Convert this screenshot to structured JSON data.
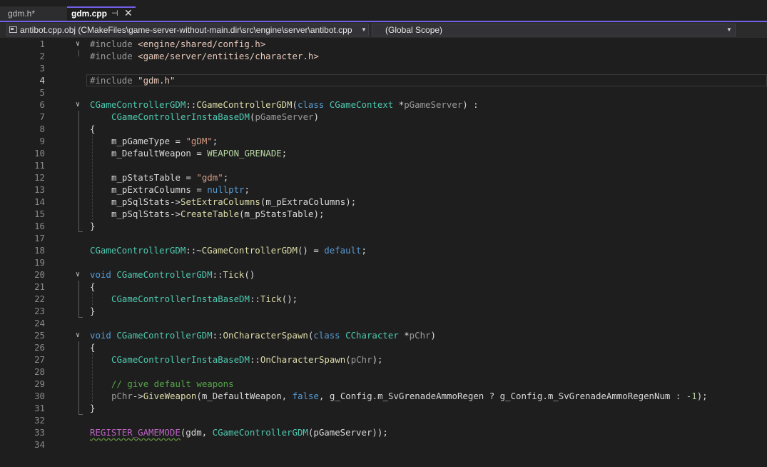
{
  "tabs": {
    "inactive_label": "gdm.h*",
    "active_label": "gdm.cpp",
    "pin_glyph": "⊣",
    "close_glyph": "✕"
  },
  "navbar": {
    "file_label": "antibot.cpp.obj (CMakeFiles\\game-server-without-main.dir\\src\\engine\\server\\antibot.cpp",
    "scope_label": "(Global Scope)",
    "dropdown_glyph": "▼"
  },
  "editor": {
    "current_line": 4,
    "line_numbers": [
      "1",
      "2",
      "3",
      "4",
      "5",
      "6",
      "7",
      "8",
      "9",
      "10",
      "11",
      "12",
      "13",
      "14",
      "15",
      "16",
      "17",
      "18",
      "19",
      "20",
      "21",
      "22",
      "23",
      "24",
      "25",
      "26",
      "27",
      "28",
      "29",
      "30",
      "31",
      "32",
      "33",
      "34"
    ],
    "fold_glyph": "∨",
    "lines": {
      "l1": [
        "#include ",
        "<engine/shared/config.h>"
      ],
      "l2": [
        "#include ",
        "<game/server/entities/character.h>"
      ],
      "l4": [
        "#include ",
        "\"gdm.h\""
      ],
      "l6": [
        "CGameControllerGDM",
        "::",
        "CGameControllerGDM",
        "(",
        "class",
        " ",
        "CGameContext",
        " *",
        "pGameServer",
        ") :"
      ],
      "l7": [
        "CGameControllerInstaBaseDM",
        "(",
        "pGameServer",
        ")"
      ],
      "l8": [
        "{"
      ],
      "l9": [
        "m_pGameType",
        " = ",
        "\"gDM\"",
        ";"
      ],
      "l10": [
        "m_DefaultWeapon",
        " = ",
        "WEAPON_GRENADE",
        ";"
      ],
      "l12": [
        "m_pStatsTable",
        " = ",
        "\"gdm\"",
        ";"
      ],
      "l13": [
        "m_pExtraColumns",
        " = ",
        "nullptr",
        ";"
      ],
      "l14": [
        "m_pSqlStats",
        "->",
        "SetExtraColumns",
        "(",
        "m_pExtraColumns",
        ");"
      ],
      "l15": [
        "m_pSqlStats",
        "->",
        "CreateTable",
        "(",
        "m_pStatsTable",
        ");"
      ],
      "l16": [
        "}"
      ],
      "l18": [
        "CGameControllerGDM",
        "::~",
        "CGameControllerGDM",
        "() = ",
        "default",
        ";"
      ],
      "l20": [
        "void",
        " ",
        "CGameControllerGDM",
        "::",
        "Tick",
        "()"
      ],
      "l21": [
        "{"
      ],
      "l22": [
        "CGameControllerInstaBaseDM",
        "::",
        "Tick",
        "();"
      ],
      "l23": [
        "}"
      ],
      "l25": [
        "void",
        " ",
        "CGameControllerGDM",
        "::",
        "OnCharacterSpawn",
        "(",
        "class",
        " ",
        "CCharacter",
        " *",
        "pChr",
        ")"
      ],
      "l26": [
        "{"
      ],
      "l27": [
        "CGameControllerInstaBaseDM",
        "::",
        "OnCharacterSpawn",
        "(",
        "pChr",
        ");"
      ],
      "l29": [
        "// give default weapons"
      ],
      "l30": [
        "pChr",
        "->",
        "GiveWeapon",
        "(",
        "m_DefaultWeapon",
        ", ",
        "false",
        ", ",
        "g_Config",
        ".",
        "m_SvGrenadeAmmoRegen",
        " ? ",
        "g_Config",
        ".",
        "m_SvGrenadeAmmoRegenNum",
        " : ",
        "-1",
        ");"
      ],
      "l31": [
        "}"
      ],
      "l33": [
        "REGISTER_GAMEMODE",
        "(",
        "gdm",
        ", ",
        "CGameControllerGDM",
        "(",
        "pGameServer",
        "));"
      ]
    }
  }
}
